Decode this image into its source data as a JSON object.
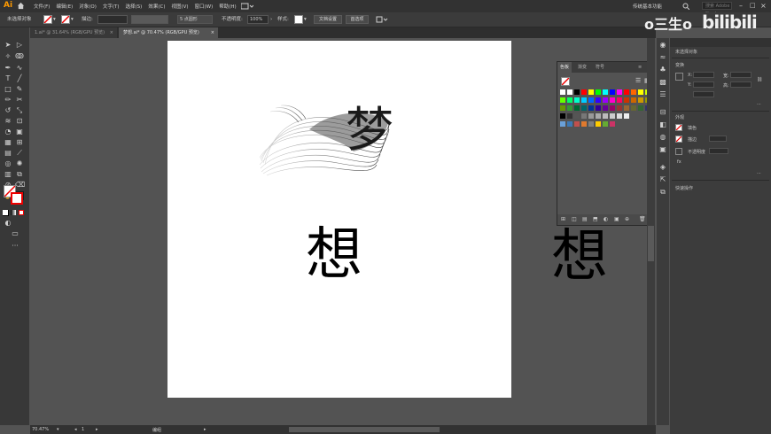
{
  "menubar": {
    "logo": "Ai",
    "menus": [
      "文件(F)",
      "编辑(E)",
      "对象(O)",
      "文字(T)",
      "选择(S)",
      "效果(C)",
      "视图(V)",
      "窗口(W)",
      "帮助(H)"
    ],
    "workspace": "传统基本功能",
    "search_placeholder": "搜索 Adobe Stock"
  },
  "controlbar": {
    "selection_label": "未选择对象",
    "stroke_label": "描边:",
    "brush_label": "5 点圆形",
    "opacity_label": "不透明度:",
    "opacity_value": "100%",
    "style_label": "样式:",
    "doc_setup_button": "文档设置",
    "preferences_button": "首选项"
  },
  "tabs": [
    {
      "label": "1.ai* @ 31.64% (RGB/GPU 预览)",
      "active": false
    },
    {
      "label": "梦想.ai* @ 70.47% (RGB/GPU 预览)",
      "active": true
    }
  ],
  "canvas": {
    "char_dream": "梦",
    "char_think": "想",
    "char_think_right": "想"
  },
  "swatch_panel": {
    "tabs": [
      "色板",
      "渐变",
      "符号"
    ]
  },
  "properties_panel": {
    "title": "未选择对象",
    "transform_label": "变换",
    "x_label": "X:",
    "y_label": "Y:",
    "w_label": "宽:",
    "h_label": "高:",
    "appearance_label": "外观",
    "fill_label": "填色",
    "stroke_label": "描边",
    "opacity_label": "不透明度",
    "quick_actions_label": "快速操作"
  },
  "statusbar": {
    "zoom": "70.47%",
    "page": "1",
    "tool": "编组"
  },
  "watermark": {
    "user": "o三生o",
    "site": "bilibili"
  }
}
